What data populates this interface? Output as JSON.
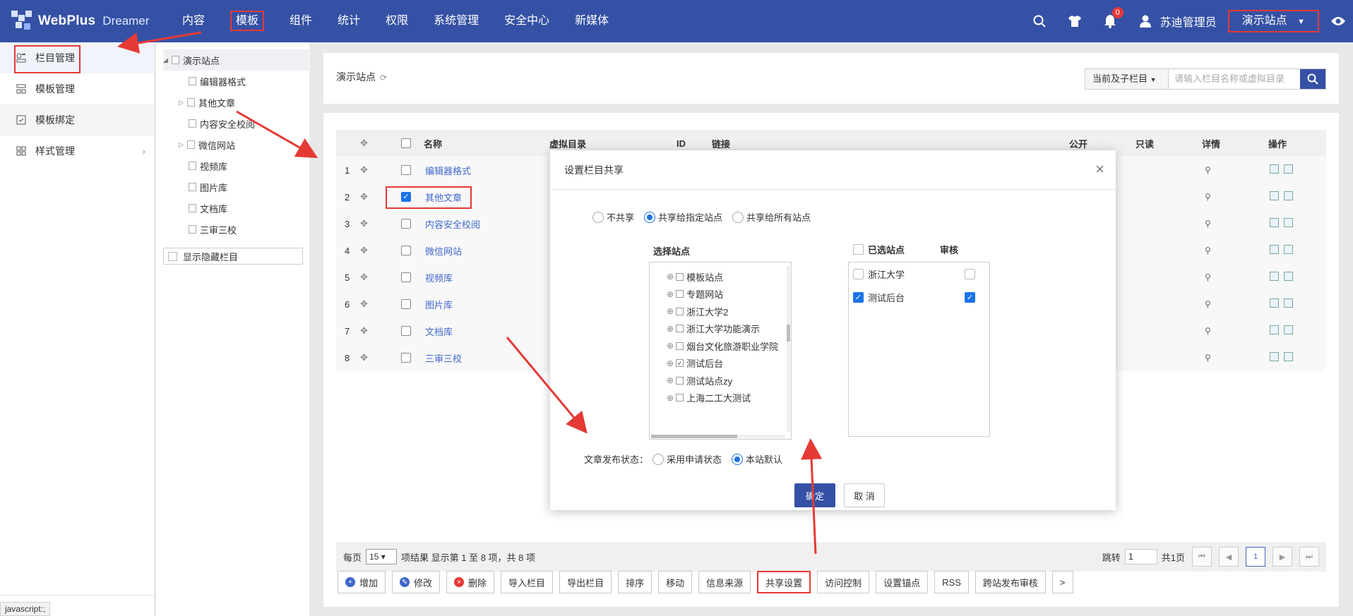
{
  "header": {
    "logo_text": "WebPlus",
    "logo_sub": "Dreamer",
    "nav": [
      "内容",
      "模板",
      "组件",
      "统计",
      "权限",
      "系统管理",
      "安全中心",
      "新媒体"
    ],
    "active_nav_index": 1,
    "notification_count": "0",
    "user_name": "苏迪管理员",
    "site_switcher": "演示站点"
  },
  "sidebar": {
    "items": [
      {
        "label": "栏目管理",
        "icon": "column-icon"
      },
      {
        "label": "模板管理",
        "icon": "template-icon"
      },
      {
        "label": "模板绑定",
        "icon": "bind-icon"
      },
      {
        "label": "样式管理",
        "icon": "style-icon"
      }
    ],
    "status_tip": "javascript:;"
  },
  "tree": {
    "root": "演示站点",
    "nodes": [
      "编辑器格式",
      "其他文章",
      "内容安全校阅",
      "微信网站",
      "视频库",
      "图片库",
      "文档库",
      "三审三校"
    ],
    "show_hidden": "显示隐藏栏目"
  },
  "panel": {
    "title": "演示站点",
    "scope": "当前及子栏目",
    "search_placeholder": "请输入栏目名称或虚拟目录"
  },
  "grid": {
    "headers": {
      "name": "名称",
      "vdir": "虚拟目录",
      "id": "ID",
      "link": "链接",
      "public": "公开",
      "readonly": "只读",
      "detail": "详情",
      "ops": "操作"
    },
    "rows": [
      {
        "no": "1",
        "name": "编辑器格式",
        "checked": false
      },
      {
        "no": "2",
        "name": "其他文章",
        "checked": true
      },
      {
        "no": "3",
        "name": "内容安全校阅",
        "checked": false
      },
      {
        "no": "4",
        "name": "微信网站",
        "checked": false
      },
      {
        "no": "5",
        "name": "视频库",
        "checked": false
      },
      {
        "no": "6",
        "name": "图片库",
        "checked": false
      },
      {
        "no": "7",
        "name": "文档库",
        "checked": false
      },
      {
        "no": "8",
        "name": "三审三校",
        "checked": false
      }
    ]
  },
  "pager": {
    "per_page_label": "每页",
    "per_page": "15",
    "summary": "项结果 显示第 1 至 8 项，共 8 项",
    "jump_label": "跳转",
    "jump_value": "1",
    "total_pages": "共1页",
    "current_page": "1"
  },
  "actions": [
    {
      "label": "增加",
      "icon": "plus-icon",
      "color": "#3f67c9"
    },
    {
      "label": "修改",
      "icon": "edit-icon",
      "color": "#3f67c9"
    },
    {
      "label": "删除",
      "icon": "delete-icon",
      "color": "#e53935"
    },
    {
      "label": "导入栏目"
    },
    {
      "label": "导出栏目"
    },
    {
      "label": "排序"
    },
    {
      "label": "移动"
    },
    {
      "label": "信息来源"
    },
    {
      "label": "共享设置"
    },
    {
      "label": "访问控制"
    },
    {
      "label": "设置锚点"
    },
    {
      "label": "RSS"
    },
    {
      "label": "跨站发布审核"
    },
    {
      "label": ">"
    }
  ],
  "modal": {
    "title": "设置栏目共享",
    "share_options": [
      "不共享",
      "共享给指定站点",
      "共享给所有站点"
    ],
    "share_selected": 1,
    "select_sites_label": "选择站点",
    "sites": [
      {
        "name": "模板站点",
        "checked": false
      },
      {
        "name": "专题网站",
        "checked": false
      },
      {
        "name": "浙江大学2",
        "checked": false
      },
      {
        "name": "浙江大学功能演示",
        "checked": false
      },
      {
        "name": "烟台文化旅游职业学院",
        "checked": false
      },
      {
        "name": "测试后台",
        "checked": true
      },
      {
        "name": "测试站点zy",
        "checked": false
      },
      {
        "name": "上海二工大测试",
        "checked": false
      }
    ],
    "selected_label": "已选站点",
    "review_label": "审核",
    "selected_sites": [
      {
        "name": "浙江大学",
        "checked": false,
        "review": false
      },
      {
        "name": "测试后台",
        "checked": true,
        "review": true
      }
    ],
    "publish_state_label": "文章发布状态：",
    "publish_options": [
      "采用申请状态",
      "本站默认"
    ],
    "publish_selected": 1,
    "ok": "确定",
    "cancel": "取 消"
  },
  "colors": {
    "primary": "#3551a5",
    "accent": "#1a73e8",
    "annotation": "#e53935",
    "link": "#3f67c9"
  }
}
